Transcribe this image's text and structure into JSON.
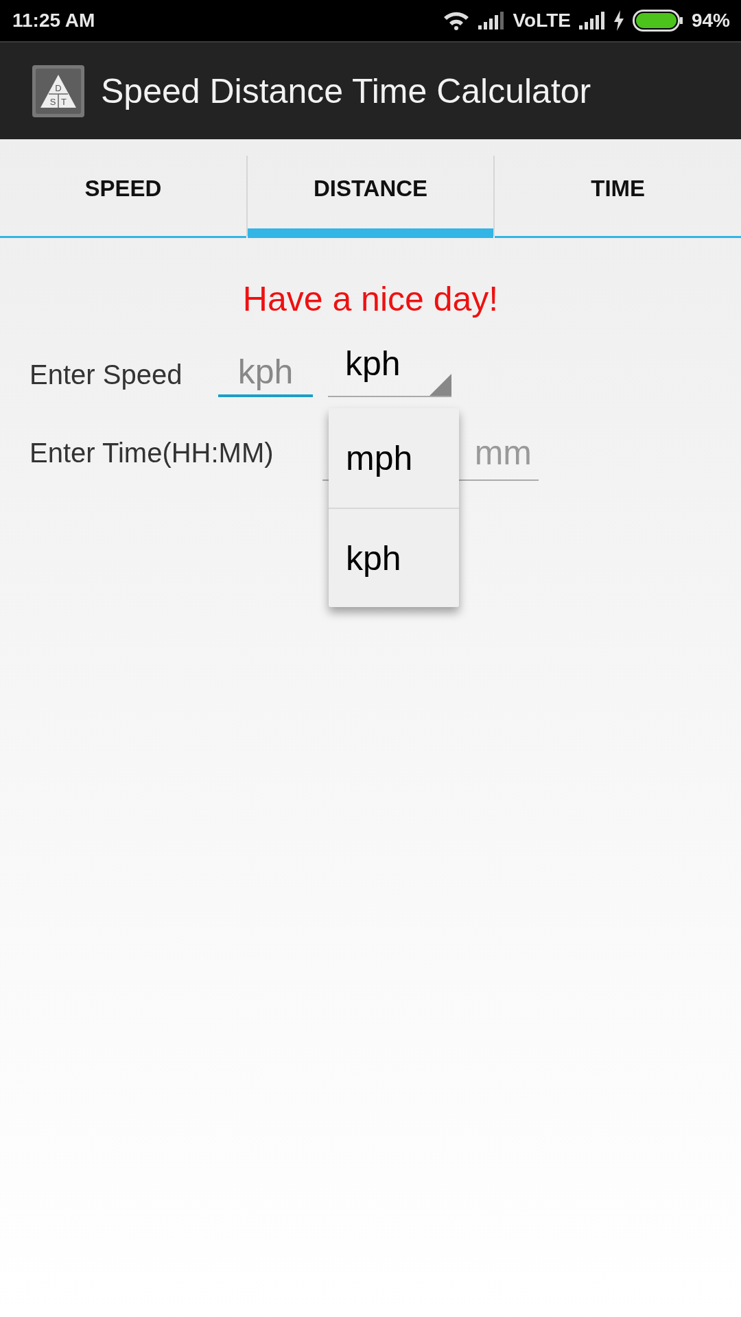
{
  "status_bar": {
    "time": "11:25 AM",
    "network": "VoLTE",
    "battery": "94%"
  },
  "app_bar": {
    "icon_letters": [
      "D",
      "S",
      "T"
    ],
    "title": "Speed Distance Time Calculator"
  },
  "tabs": [
    {
      "label": "SPEED",
      "selected": false
    },
    {
      "label": "DISTANCE",
      "selected": true
    },
    {
      "label": "TIME",
      "selected": false
    }
  ],
  "message": "Have a nice day!",
  "speed": {
    "label": "Enter Speed",
    "placeholder": "kph",
    "unit": "kph"
  },
  "time": {
    "label": "Enter Time(HH:MM)",
    "placeholder": "mm"
  },
  "dropdown": {
    "options": [
      "mph",
      "kph"
    ]
  }
}
